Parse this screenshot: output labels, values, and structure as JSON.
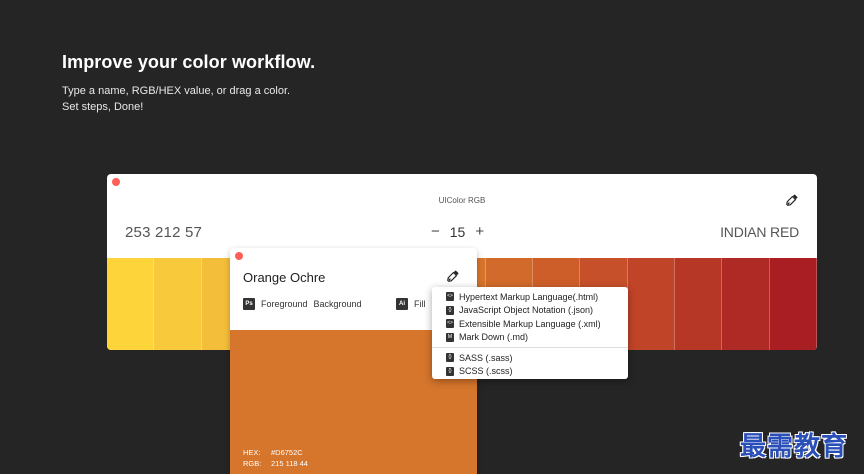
{
  "hero": {
    "title": "Improve your color workflow.",
    "subtitle_line1": "Type a name, RGB/HEX value, or drag a color.",
    "subtitle_line2": "Set steps, Done!"
  },
  "main_window": {
    "title": "UIColor RGB",
    "rgb_value": "253 212 57",
    "stepper": {
      "minus": "−",
      "value": "15",
      "plus": "+"
    },
    "color_name": "INDIAN RED",
    "picker_icon": "eyedropper-icon",
    "swatches": [
      "#FDD439",
      "#F8C93B",
      "#F3BE3A",
      "#EEB239",
      "#E9A237",
      "#E28F33",
      "#DC7E2F",
      "#D6752C",
      "#D26A2B",
      "#CD5E2A",
      "#C65029",
      "#C04428",
      "#B73726",
      "#AF2A24",
      "#A81E22"
    ]
  },
  "card": {
    "name": "Orange Ochre",
    "swatch_color": "#D6752C",
    "picker_icon": "eyedropper-icon",
    "ps_badge": "Ps",
    "foreground_label": "Foreground",
    "background_label": "Background",
    "ai_badge": "Ai",
    "fill_label": "Fill",
    "hex_label": "HEX:",
    "hex_value": "#D6752C",
    "rgb_label": "RGB:",
    "rgb_value": "215 118 44"
  },
  "export_menu": {
    "group1": [
      {
        "label": "Hypertext Markup Language(.html)",
        "icon": "html-file-icon",
        "glyph": "<>"
      },
      {
        "label": "JavaScript Object Notation (.json)",
        "icon": "json-file-icon",
        "glyph": "{}"
      },
      {
        "label": "Extensible Markup Language (.xml)",
        "icon": "xml-file-icon",
        "glyph": "<>"
      },
      {
        "label": "Mark Down (.md)",
        "icon": "markdown-file-icon",
        "glyph": "M"
      }
    ],
    "group2": [
      {
        "label": "SASS (.sass)",
        "icon": "sass-file-icon",
        "glyph": "{}"
      },
      {
        "label": "SCSS (.scss)",
        "icon": "scss-file-icon",
        "glyph": "{}"
      }
    ]
  },
  "watermark": "最需教育"
}
